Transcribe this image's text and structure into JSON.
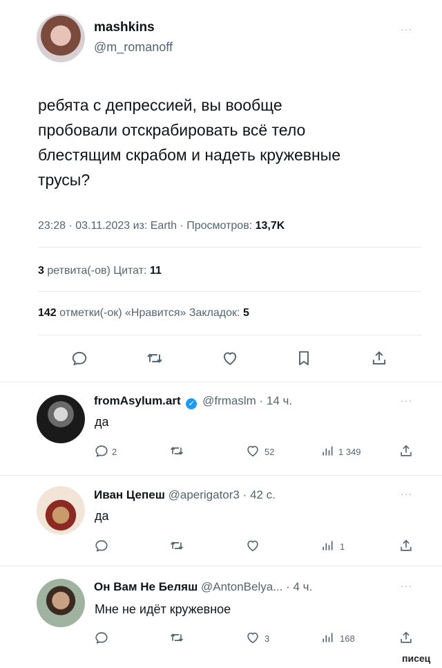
{
  "author": {
    "name": "mashkins",
    "handle": "@m_romanoff"
  },
  "tweet": {
    "text_lines": [
      "ребята с депрессией, вы вообще",
      "пробовали отскрабировать всё тело",
      "блестящим скрабом и надеть кружевные",
      "трусы?"
    ],
    "meta_prefix": "23:28 · 03.11.2023 из: Earth · Просмотров: ",
    "views": "13,7K"
  },
  "stats": {
    "retweets_count": "3",
    "retweets_label": " ретвита(-ов)  Цитат: ",
    "quotes_count": "11",
    "likes_count": "142",
    "likes_label": " отметки(-ок) «Нравится»  Закладок: ",
    "bookmarks_count": "5"
  },
  "replies": [
    {
      "name": "fromAsylum.art",
      "handle": "@frmaslm · 14 ч.",
      "text": "да",
      "reply_count": "2",
      "retweet_count": "",
      "like_count": "52",
      "view_count": "1 349"
    },
    {
      "name": "Иван Цепеш",
      "handle": "@aperigator3 · 42 с.",
      "text": "да",
      "reply_count": "",
      "retweet_count": "",
      "like_count": "",
      "view_count": "1"
    },
    {
      "name": "Он Вам Не Беляш",
      "handle": "@AntonBelya... · 4 ч.",
      "text": "Мне не идёт кружевное",
      "reply_count": "",
      "retweet_count": "",
      "like_count": "3",
      "view_count": "168"
    }
  ],
  "more_label": "···",
  "watermark": "писец",
  "colors": {
    "verified": "#1d9bf0",
    "text": "#0f1419",
    "muted": "#536471",
    "divider": "#e7e9ea"
  }
}
